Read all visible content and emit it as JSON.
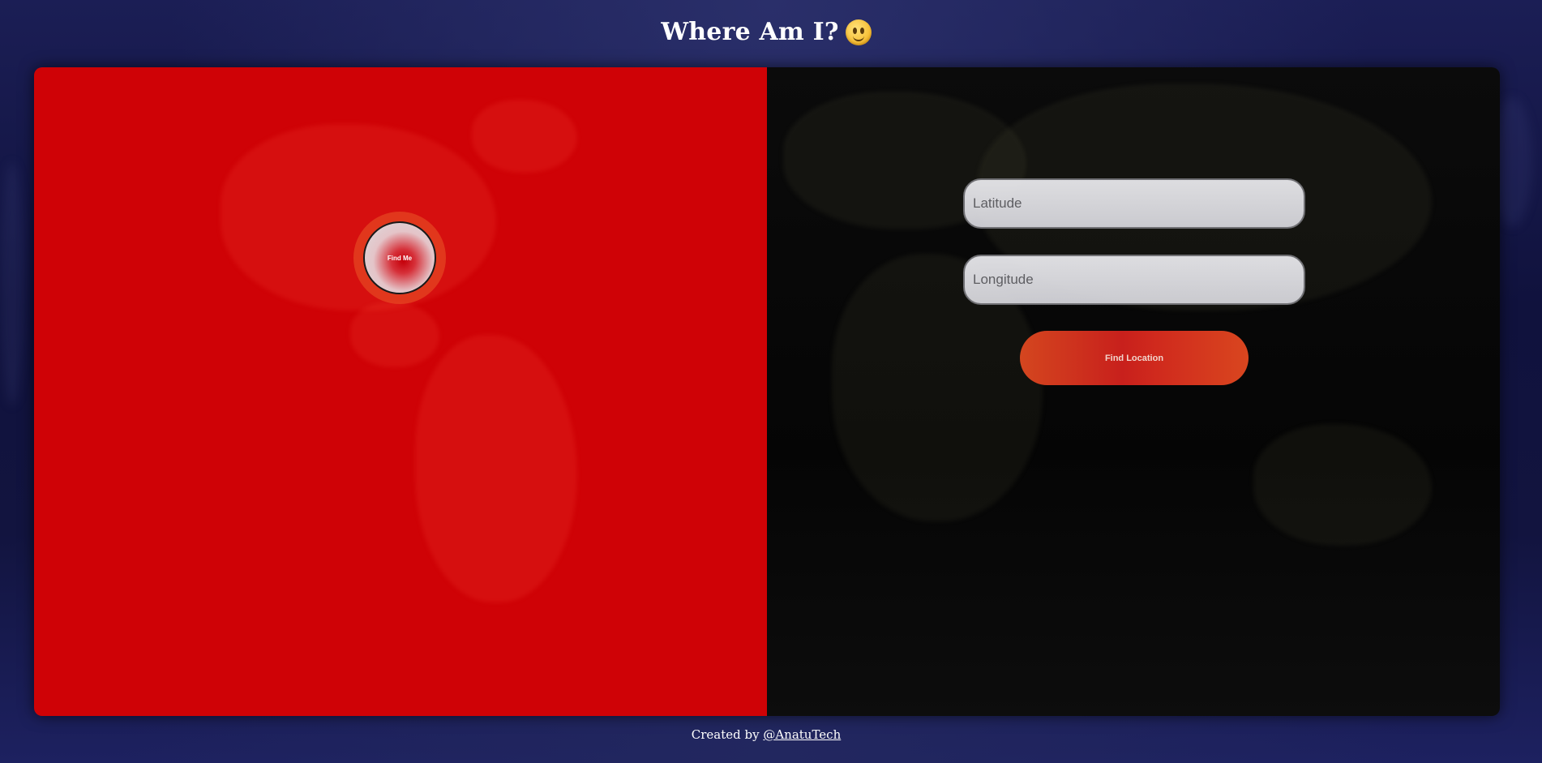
{
  "header": {
    "title": "Where Am I?",
    "emoji_icon": "smiling-face-icon"
  },
  "map_panel": {
    "background_color": "#cf0206",
    "find_me_label": "Find Me"
  },
  "coordinates_form": {
    "latitude": {
      "value": "",
      "placeholder": "Latitude"
    },
    "longitude": {
      "value": "",
      "placeholder": "Longitude"
    },
    "submit_label": "Find Location"
  },
  "footer": {
    "prefix": "Created by",
    "author_link": "@AnatuTech"
  },
  "colors": {
    "page_background": "#12143f",
    "accent": "#d4461f"
  }
}
